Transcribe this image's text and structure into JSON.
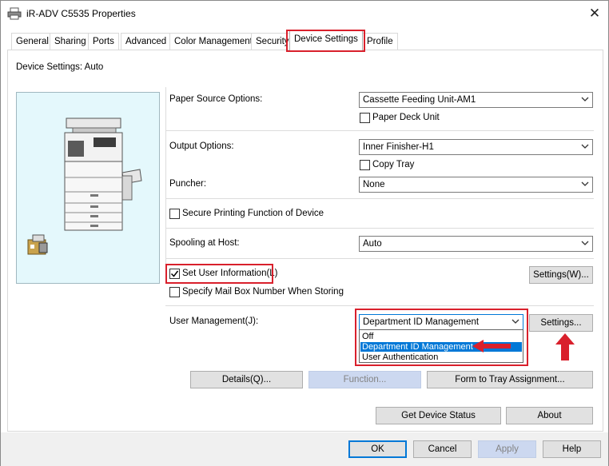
{
  "window": {
    "title": "iR-ADV C5535 Properties",
    "close_glyph": "✕",
    "printer_icon": "printer-icon"
  },
  "tabs": [
    {
      "label": "General"
    },
    {
      "label": "Sharing"
    },
    {
      "label": "Ports"
    },
    {
      "label": "Advanced"
    },
    {
      "label": "Color Management"
    },
    {
      "label": "Security"
    },
    {
      "label": "Device Settings",
      "active": true
    },
    {
      "label": "Profile"
    }
  ],
  "header": {
    "device_settings_label": "Device Settings: Auto"
  },
  "options": {
    "paper_source_label": "Paper Source Options:",
    "paper_source_value": "Cassette Feeding Unit-AM1",
    "paper_deck_label": "Paper Deck Unit",
    "paper_deck_checked": false,
    "output_label": "Output Options:",
    "output_value": "Inner Finisher-H1",
    "copy_tray_label": "Copy Tray",
    "copy_tray_checked": false,
    "puncher_label": "Puncher:",
    "puncher_value": "None",
    "secure_printing_label": "Secure Printing Function of Device",
    "secure_printing_checked": false,
    "spooling_label": "Spooling at Host:",
    "spooling_value": "Auto",
    "set_user_info_label": "Set User Information(L)",
    "set_user_info_checked": true,
    "settings_w_label": "Settings(W)...",
    "mailbox_label": "Specify Mail Box Number When Storing",
    "mailbox_checked": false,
    "user_mgmt_label": "User Management(J):",
    "user_mgmt_value": "Department ID Management",
    "user_mgmt_options": [
      "Off",
      "Department ID Management",
      "User Authentication"
    ],
    "user_mgmt_selected_index": 1,
    "settings_label": "Settings..."
  },
  "buttons": {
    "details": "Details(Q)...",
    "function": "Function...",
    "form_to_tray": "Form to Tray Assignment...",
    "get_device_status": "Get Device Status",
    "about": "About",
    "ok": "OK",
    "cancel": "Cancel",
    "apply": "Apply",
    "help": "Help"
  },
  "colors": {
    "annotation_red": "#d9202c",
    "selection_blue": "#0078d7",
    "preview_bg": "#e4f8fc"
  }
}
